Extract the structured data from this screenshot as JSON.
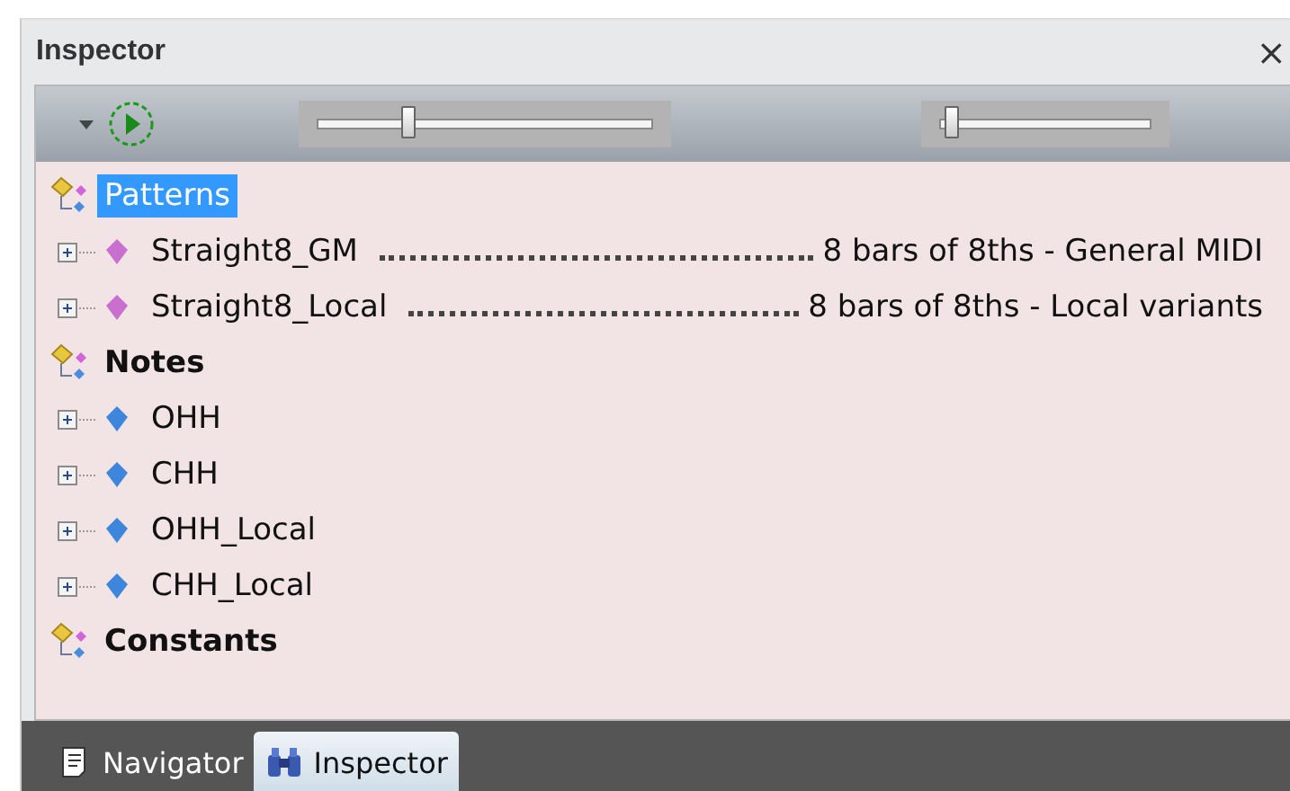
{
  "panel": {
    "title": "Inspector",
    "close": "×"
  },
  "toolbar": {
    "sliders": [
      {
        "level": 0.27
      },
      {
        "level": 0.05
      }
    ]
  },
  "tree": [
    {
      "label": "Patterns",
      "selected": true,
      "children": [
        {
          "name": "Straight8_GM",
          "description": "8 bars of 8ths - General MIDI",
          "color": "#c86fd0",
          "expanded": false,
          "selected": false
        },
        {
          "name": "Straight8_Local",
          "description": "8 bars of 8ths - Local variants",
          "color": "#c86fd0",
          "expanded": false,
          "selected": false
        }
      ]
    },
    {
      "label": "Notes",
      "selected": false,
      "children": [
        {
          "name": "OHH",
          "color": "#3d86dc",
          "expanded": false,
          "selected": false
        },
        {
          "name": "CHH",
          "color": "#3d86dc",
          "expanded": false,
          "selected": false
        },
        {
          "name": "OHH_Local",
          "color": "#3d86dc",
          "expanded": false,
          "selected": false
        },
        {
          "name": "CHH_Local",
          "color": "#3d86dc",
          "expanded": false,
          "selected": false
        }
      ]
    },
    {
      "label": "Constants",
      "selected": false
    }
  ],
  "tabs": [
    {
      "label": "Navigator",
      "kind": "navigator",
      "selected": false
    },
    {
      "label": "Inspector",
      "kind": "inspector",
      "selected": true
    }
  ]
}
